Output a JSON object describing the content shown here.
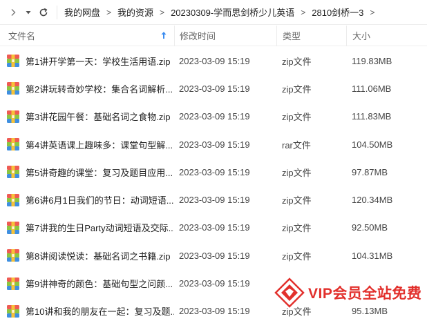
{
  "breadcrumb": [
    "我的网盘",
    "我的资源",
    "20230309-学而思剑桥少儿英语",
    "2810剑桥一3"
  ],
  "columns": {
    "name": "文件名",
    "time": "修改时间",
    "type": "类型",
    "size": "大小"
  },
  "files": [
    {
      "name": "第1讲开学第一天：学校生活用语.zip",
      "time": "2023-03-09 15:19",
      "type": "zip文件",
      "size": "119.83MB"
    },
    {
      "name": "第2讲玩转奇妙学校：集合名词解析...",
      "time": "2023-03-09 15:19",
      "type": "zip文件",
      "size": "111.06MB"
    },
    {
      "name": "第3讲花园午餐：基础名词之食物.zip",
      "time": "2023-03-09 15:19",
      "type": "zip文件",
      "size": "111.83MB"
    },
    {
      "name": "第4讲英语课上趣味多：课堂句型解...",
      "time": "2023-03-09 15:19",
      "type": "rar文件",
      "size": "104.50MB"
    },
    {
      "name": "第5讲奇趣的课堂：复习及题目应用...",
      "time": "2023-03-09 15:19",
      "type": "zip文件",
      "size": "97.87MB"
    },
    {
      "name": "第6讲6月1日我们的节日：动词短语...",
      "time": "2023-03-09 15:19",
      "type": "zip文件",
      "size": "120.34MB"
    },
    {
      "name": "第7讲我的生日Party动词短语及交际...",
      "time": "2023-03-09 15:19",
      "type": "zip文件",
      "size": "92.50MB"
    },
    {
      "name": "第8讲阅读悦读：基础名词之书籍.zip",
      "time": "2023-03-09 15:19",
      "type": "zip文件",
      "size": "104.31MB"
    },
    {
      "name": "第9讲神奇的颜色：基础句型之问颜...",
      "time": "2023-03-09 15:19",
      "type": "",
      "size": ""
    },
    {
      "name": "第10讲和我的朋友在一起：复习及题...",
      "time": "2023-03-09 15:19",
      "type": "zip文件",
      "size": "95.13MB"
    }
  ],
  "watermark": {
    "text": "VIP会员全站免费",
    "color": "#e2302c"
  },
  "colors": {
    "accent": "#3b8cf0",
    "border": "#eeeeee"
  }
}
